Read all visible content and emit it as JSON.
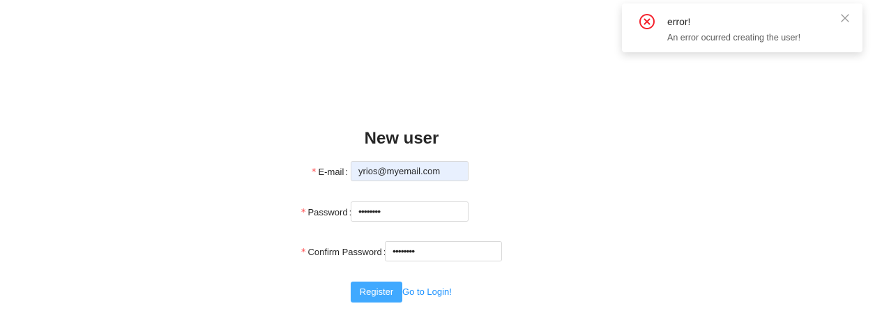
{
  "notification": {
    "type": "error",
    "icon": "close-circle-icon",
    "title": "error!",
    "description": "An error ocurred creating the user!",
    "close_icon": "close-icon",
    "accent_color": "#f5222d"
  },
  "form": {
    "title": "New user",
    "required_marker": "*",
    "email": {
      "label": "E-mail",
      "value": "yrios@myemail.com"
    },
    "password": {
      "label": "Password",
      "value": "••••••••"
    },
    "confirm_password": {
      "label": "Confirm Password",
      "value": "••••••••"
    },
    "register_button": "Register",
    "login_link": "Go to Login!"
  },
  "colors": {
    "primary": "#40a9ff",
    "link": "#1890ff",
    "required": "#ff4d4f",
    "autofill_bg": "#e8f0fe"
  }
}
